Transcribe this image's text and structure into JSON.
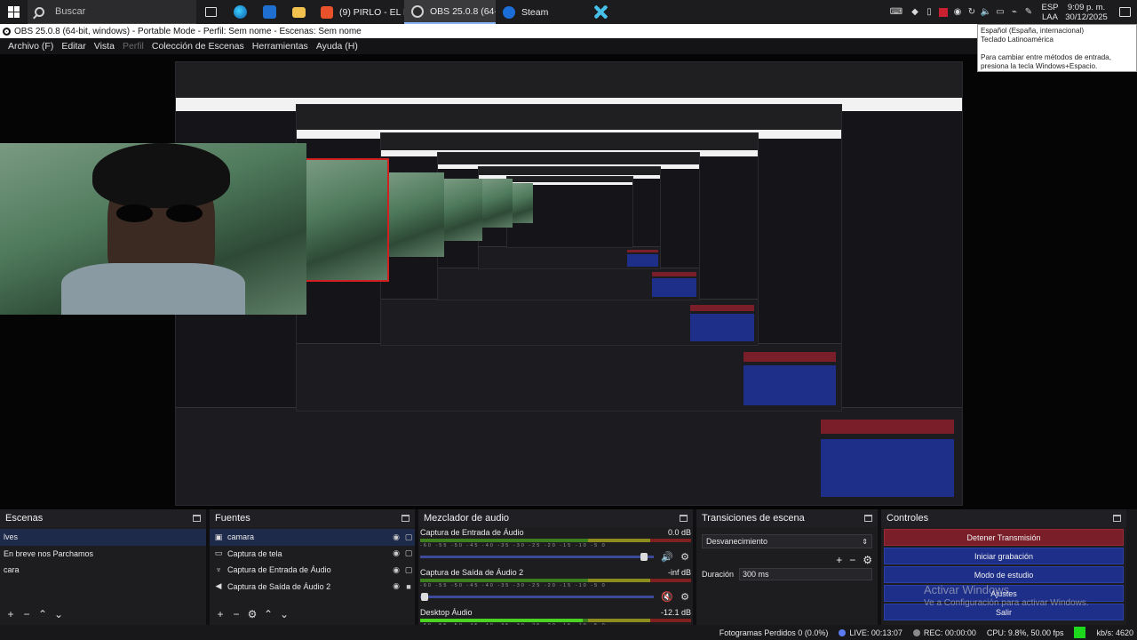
{
  "taskbar": {
    "search_placeholder": "Buscar",
    "tasks": [
      {
        "label": "(9) PIRLO - EL FICTI...",
        "icon": "brave-icon",
        "color": "#e8512a"
      },
      {
        "label": "OBS 25.0.8 (64-bit, ...",
        "icon": "obs-icon",
        "color": "#3a3a3a"
      },
      {
        "label": "Steam",
        "icon": "steam-icon",
        "color": "#1b6ed8"
      }
    ],
    "lang": {
      "line1": "ESP",
      "line2": "LAA"
    },
    "clock": {
      "time": "9:09 p. m.",
      "date": "30/12/2025"
    }
  },
  "window": {
    "title": "OBS 25.0.8 (64-bit, windows) - Portable Mode - Perfil: Sem nome - Escenas: Sem nome"
  },
  "menu": {
    "items": [
      "Archivo (F)",
      "Editar",
      "Vista",
      "Perfil",
      "Colección de Escenas",
      "Herramientas",
      "Ayuda (H)"
    ]
  },
  "tooltip": {
    "line1": "Español (España, internacional)",
    "line2": "Teclado Latinoamérica",
    "line3": "Para cambiar entre métodos de entrada, presiona la tecla Windows+Espacio."
  },
  "scenes": {
    "title": "Escenas",
    "items": [
      "lves",
      "En breve nos Parchamos",
      "cara"
    ]
  },
  "sources": {
    "title": "Fuentes",
    "items": [
      {
        "label": "camara",
        "icon": "camera-icon"
      },
      {
        "label": "Captura de tela",
        "icon": "monitor-icon"
      },
      {
        "label": "Captura de Entrada de Áudio",
        "icon": "microphone-icon"
      },
      {
        "label": "Captura de Saída de Áudio 2",
        "icon": "speaker-icon"
      }
    ]
  },
  "mixer": {
    "title": "Mezclador de audio",
    "channels": [
      {
        "name": "Captura de Entrada de Áudio",
        "db": "0.0 dB",
        "level": 0.0,
        "volume": 0.96,
        "muted": false
      },
      {
        "name": "Captura de Saída de Áudio 2",
        "db": "-inf dB",
        "level": 0.0,
        "volume": 0.02,
        "muted": true
      },
      {
        "name": "Desktop Áudio",
        "db": "-12.1 dB",
        "level": 0.6,
        "volume": 0.9,
        "muted": false
      }
    ],
    "ticks": "-60 -55 -50 -45 -40 -35 -30 -25 -20 -15 -10 -5 0"
  },
  "transitions": {
    "title": "Transiciones de escena",
    "selected": "Desvanecimiento",
    "duration_label": "Duración",
    "duration_value": "300 ms"
  },
  "controls": {
    "title": "Controles",
    "buttons": [
      "Detener Transmisión",
      "Iniciar grabación",
      "Modo de estudio",
      "Ajustes",
      "Salir"
    ]
  },
  "activation": {
    "title": "Activar Windows",
    "subtitle": "Ve a Configuración para activar Windows."
  },
  "status": {
    "dropped": "Fotogramas Perdidos 0 (0.0%)",
    "live": "LIVE: 00:13:07",
    "rec": "REC: 00:00:00",
    "cpu": "CPU: 9.8%, 50.00 fps",
    "kbps": "kb/s: 4620"
  },
  "colors": {
    "stop_button": "#7a1f2a",
    "control_button": "#1e2f8a",
    "meter_green": "#4ad421",
    "live_indicator": "#1ed81e"
  }
}
